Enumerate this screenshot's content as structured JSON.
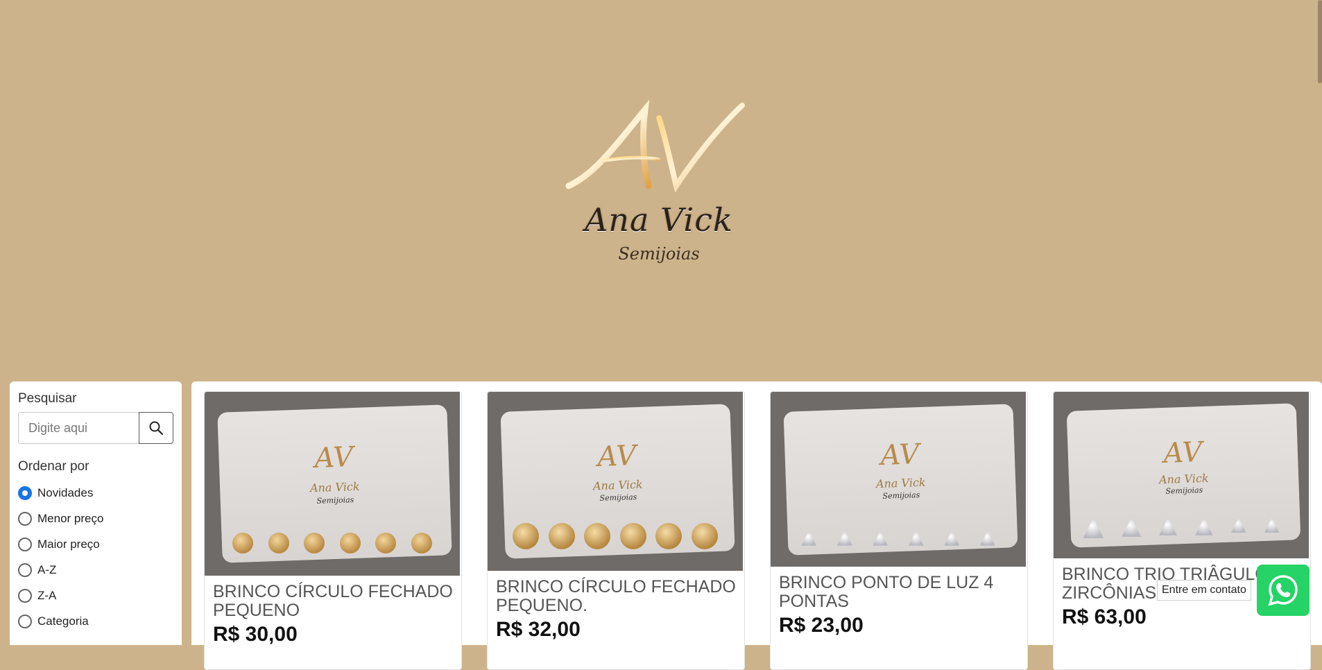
{
  "brand": {
    "monogram": "AV",
    "name": "Ana Vick",
    "subtitle": "Semijoias"
  },
  "sidebar": {
    "search_label": "Pesquisar",
    "search_placeholder": "Digite aqui",
    "sort_label": "Ordenar por",
    "sort_options": [
      {
        "label": "Novidades",
        "selected": true
      },
      {
        "label": "Menor preço",
        "selected": false
      },
      {
        "label": "Maior preço",
        "selected": false
      },
      {
        "label": "A-Z",
        "selected": false
      },
      {
        "label": "Z-A",
        "selected": false
      },
      {
        "label": "Categoria",
        "selected": false
      }
    ]
  },
  "products": [
    {
      "title": "BRINCO CÍRCULO FECHADO PEQUENO",
      "price": "R$ 30,00",
      "image": "gold-round-studs"
    },
    {
      "title": "BRINCO CÍRCULO FECHADO PEQUENO.",
      "price": "R$ 32,00",
      "image": "gold-large-round-studs"
    },
    {
      "title": "BRINCO PONTO DE LUZ 4 PONTAS",
      "price": "R$ 23,00",
      "image": "zirconia-point-studs"
    },
    {
      "title": "BRINCO TRIO TRIÂGULO ZIRCÔNIAS",
      "price": "R$ 63,00",
      "image": "triangle-zirconia-studs"
    }
  ],
  "contact": {
    "tooltip": "Entre em contato",
    "icon": "whatsapp-icon"
  },
  "colors": {
    "background": "#cdb38b",
    "accent": "#1a73e8",
    "whatsapp": "#25d366"
  }
}
